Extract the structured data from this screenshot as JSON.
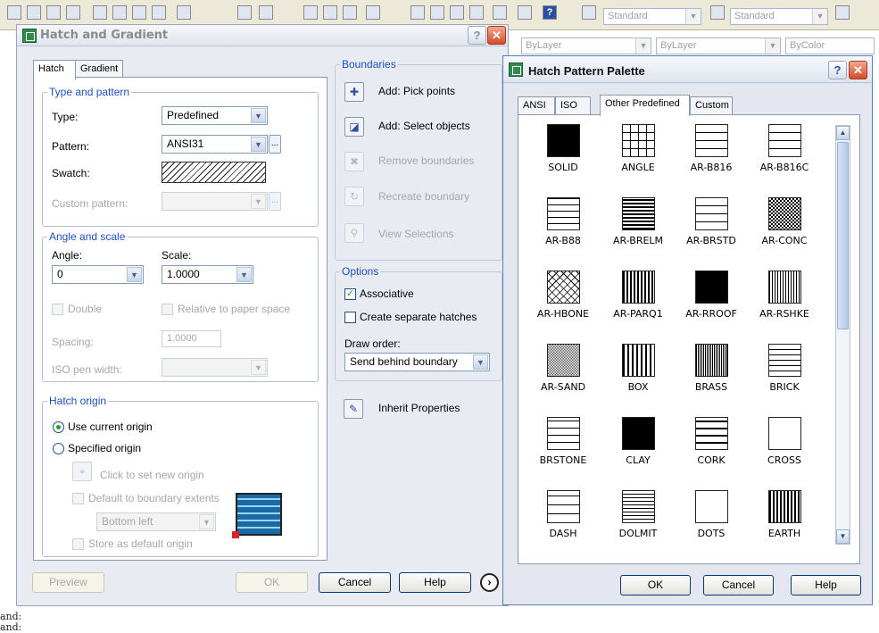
{
  "toolbar": {
    "text_style": "Standard",
    "dim_style": "Standard",
    "layer_line1": "ByLayer",
    "layer_line2": "ByLayer",
    "color": "ByColor"
  },
  "dialog": {
    "title": "Hatch and Gradient",
    "tabs": [
      "Hatch",
      "Gradient"
    ],
    "type_and_pattern": {
      "group_label": "Type and pattern",
      "type_label": "Type:",
      "type_value": "Predefined",
      "pattern_label": "Pattern:",
      "pattern_value": "ANSI31",
      "swatch_label": "Swatch:",
      "custom_label": "Custom pattern:",
      "dots": "..."
    },
    "angle_scale": {
      "group_label": "Angle and scale",
      "angle_label": "Angle:",
      "angle_value": "0",
      "scale_label": "Scale:",
      "scale_value": "1.0000",
      "double_label": "Double",
      "relative_label": "Relative to paper space",
      "spacing_label": "Spacing:",
      "spacing_value": "1.0000",
      "iso_label": "ISO pen width:"
    },
    "hatch_origin": {
      "group_label": "Hatch origin",
      "use_current": "Use current origin",
      "specified": "Specified origin",
      "click_set": "Click to set new origin",
      "default_extents": "Default to boundary extents",
      "bottom_left": "Bottom left",
      "store_default": "Store as default origin"
    },
    "boundaries": {
      "group_label": "Boundaries",
      "add_pick": "Add: Pick points",
      "add_select": "Add: Select objects",
      "remove": "Remove boundaries",
      "recreate": "Recreate boundary",
      "view": "View Selections"
    },
    "options": {
      "group_label": "Options",
      "associative": "Associative",
      "separate": "Create separate hatches",
      "draw_order_label": "Draw order:",
      "draw_order_value": "Send behind boundary"
    },
    "inherit": "Inherit Properties",
    "buttons": {
      "preview": "Preview",
      "ok": "OK",
      "cancel": "Cancel",
      "help": "Help"
    }
  },
  "palette": {
    "title": "Hatch Pattern Palette",
    "tabs": [
      "ANSI",
      "ISO",
      "Other Predefined",
      "Custom"
    ],
    "patterns": [
      "SOLID",
      "ANGLE",
      "AR-B816",
      "AR-B816C",
      "AR-B88",
      "AR-BRELM",
      "AR-BRSTD",
      "AR-CONC",
      "AR-HBONE",
      "AR-PARQ1",
      "AR-RROOF",
      "AR-RSHKE",
      "AR-SAND",
      "BOX",
      "BRASS",
      "BRICK",
      "BRSTONE",
      "CLAY",
      "CORK",
      "CROSS",
      "DASH",
      "DOLMIT",
      "DOTS",
      "EARTH"
    ],
    "buttons": {
      "ok": "OK",
      "cancel": "Cancel",
      "help": "Help"
    }
  },
  "command_line": [
    "and:",
    "and:"
  ]
}
